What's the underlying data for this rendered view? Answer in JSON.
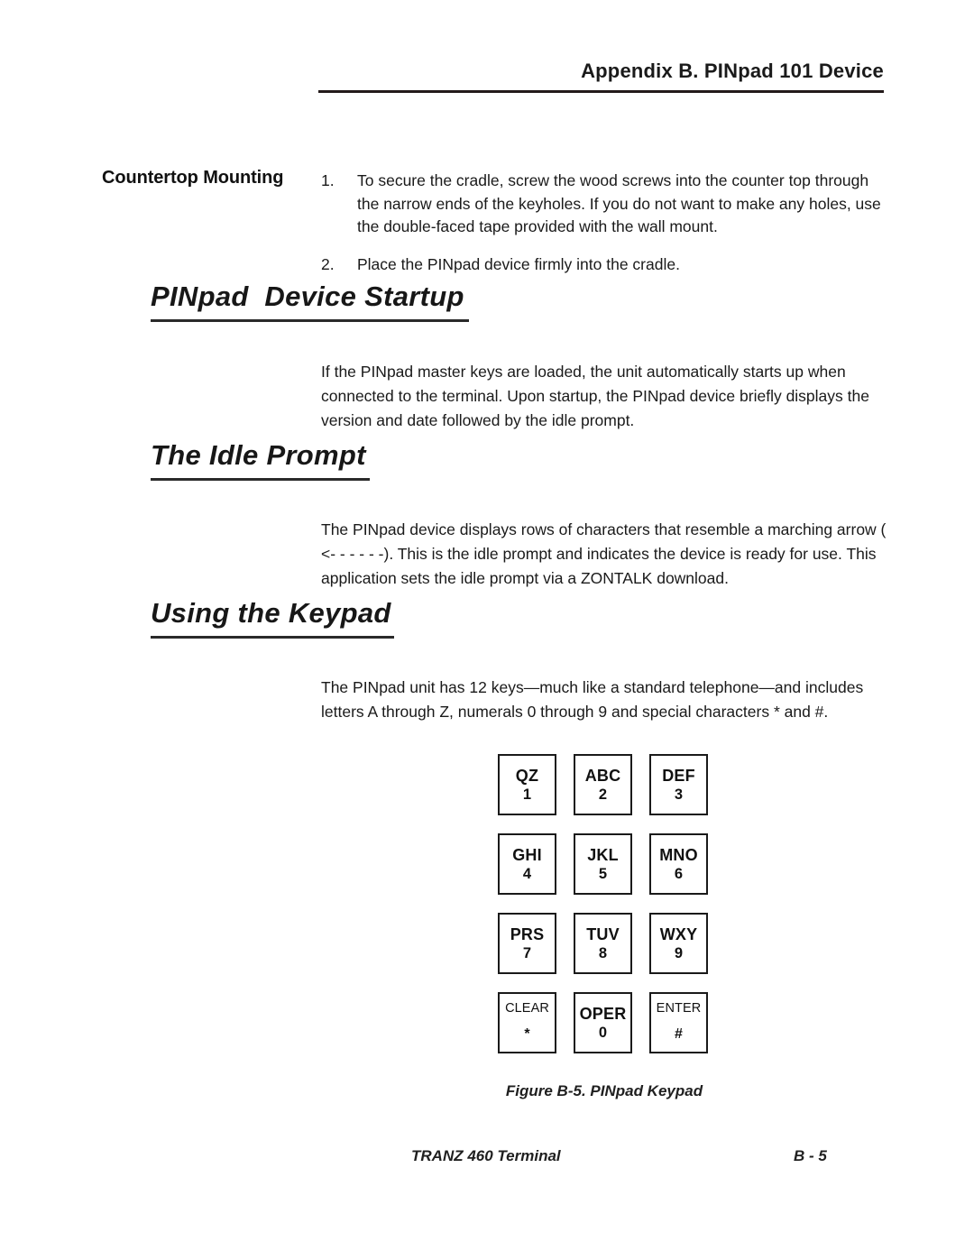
{
  "header": {
    "title": "Appendix B.  PINpad 101 Device"
  },
  "countertop": {
    "side_label": "Countertop Mounting",
    "items": [
      {
        "num": "1.",
        "text": "To secure the cradle, screw the wood screws into the counter top through the narrow ends of the keyholes. If you do not want to make any holes, use the double-faced tape provided with the wall mount."
      },
      {
        "num": "2.",
        "text": "Place the PINpad device firmly into the cradle."
      }
    ]
  },
  "sections": [
    {
      "heading": "PINpad  Device Startup",
      "body": "If the PINpad master keys are loaded, the unit automatically starts up when connected to the terminal. Upon startup, the PINpad device briefly displays the version and date followed by the idle prompt."
    },
    {
      "heading": "The Idle Prompt",
      "body": "The PINpad device displays rows of characters that resemble a marching arrow ( <- - - - - -). This is the idle prompt and indicates the device is ready for use.  This application sets the idle prompt via a ZONTALK download."
    },
    {
      "heading": "Using the Keypad",
      "body": "The PINpad unit has 12 keys—much like a standard telephone—and includes letters A through Z, numerals 0 through 9 and special characters * and #."
    }
  ],
  "keypad": {
    "rows": [
      [
        {
          "letters": "QZ",
          "digit": "1",
          "style": "normal"
        },
        {
          "letters": "ABC",
          "digit": "2",
          "style": "normal"
        },
        {
          "letters": "DEF",
          "digit": "3",
          "style": "normal"
        }
      ],
      [
        {
          "letters": "GHI",
          "digit": "4",
          "style": "normal"
        },
        {
          "letters": "JKL",
          "digit": "5",
          "style": "normal"
        },
        {
          "letters": "MNO",
          "digit": "6",
          "style": "normal"
        }
      ],
      [
        {
          "letters": "PRS",
          "digit": "7",
          "style": "normal"
        },
        {
          "letters": "TUV",
          "digit": "8",
          "style": "normal"
        },
        {
          "letters": "WXY",
          "digit": "9",
          "style": "normal"
        }
      ],
      [
        {
          "letters": "CLEAR",
          "digit": "*",
          "style": "function"
        },
        {
          "letters": "OPER",
          "digit": "0",
          "style": "normal"
        },
        {
          "letters": "ENTER",
          "digit": "#",
          "style": "function"
        }
      ]
    ],
    "caption": "Figure B-5. PINpad Keypad"
  },
  "footer": {
    "left": "TRANZ 460 Terminal",
    "right": "B - 5"
  }
}
